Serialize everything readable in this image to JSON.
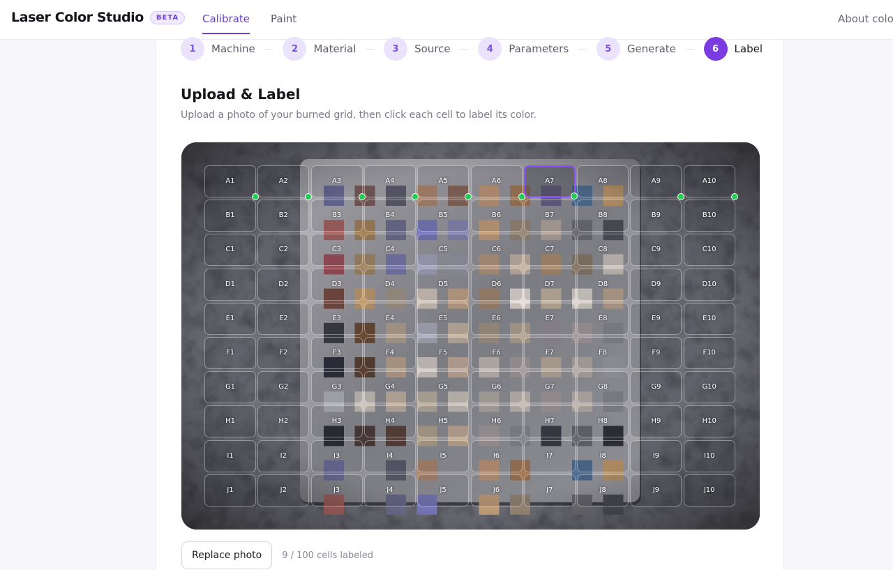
{
  "app": {
    "title": "Laser Color Studio",
    "badge": "BETA"
  },
  "nav": {
    "items": [
      "Calibrate",
      "Paint"
    ],
    "active": 0,
    "about": "About color"
  },
  "stepper": {
    "steps": [
      {
        "num": "1",
        "label": "Machine"
      },
      {
        "num": "2",
        "label": "Material"
      },
      {
        "num": "3",
        "label": "Source"
      },
      {
        "num": "4",
        "label": "Parameters"
      },
      {
        "num": "5",
        "label": "Generate"
      },
      {
        "num": "6",
        "label": "Label"
      }
    ],
    "active": 5
  },
  "section": {
    "title": "Upload & Label",
    "subtitle": "Upload a photo of your burned grid, then click each cell to label its color."
  },
  "grid": {
    "rows": [
      "A",
      "B",
      "C",
      "D",
      "E",
      "F",
      "G",
      "H",
      "I",
      "J"
    ],
    "cols": 10,
    "labeled": [
      "A1",
      "A2",
      "A3",
      "A4",
      "A5",
      "A6",
      "A7",
      "A9",
      "A10"
    ],
    "selected": "A7"
  },
  "footer": {
    "replace_label": "Replace photo",
    "count_text": "9 / 100 cells labeled"
  },
  "colors": {
    "accent": "#7a3be2",
    "labeled_dot": "#22cc55"
  }
}
